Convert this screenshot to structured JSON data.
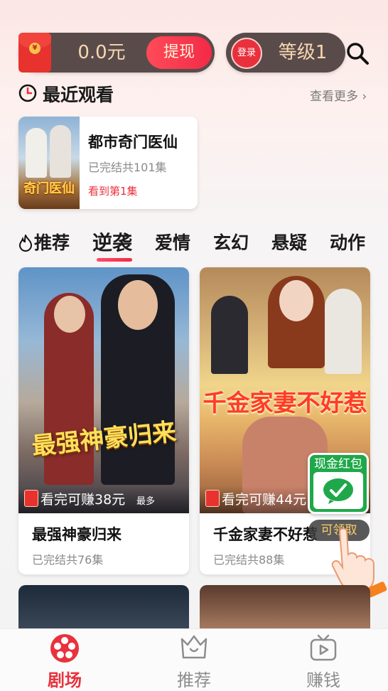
{
  "wallet": {
    "balance": "0.0元",
    "withdraw_label": "提现",
    "packet_symbol": "¥"
  },
  "level": {
    "login_label": "登录",
    "level_label": "等级1"
  },
  "recent": {
    "title": "最近观看",
    "see_more": "查看更多",
    "item": {
      "name": "都市奇门医仙",
      "poster_text": "奇门医仙",
      "episodes": "已完结共101集",
      "progress": "看到第1集"
    }
  },
  "tabs": [
    "推荐",
    "逆袭",
    "爱情",
    "玄幻",
    "悬疑",
    "动作"
  ],
  "active_tab": "逆袭",
  "cards": [
    {
      "poster_title": "最强神豪归来",
      "earn": "看完可赚38元",
      "earn_max": "最多",
      "title": "最强神豪归来",
      "episodes": "已完结共76集"
    },
    {
      "poster_title": "千金家妻不好惹",
      "earn": "看完可赚44元",
      "title": "千金家妻不好惹",
      "episodes": "已完结共88集"
    }
  ],
  "red_packet": {
    "label": "现金红包",
    "claim": "可领取"
  },
  "bottom_nav": [
    {
      "label": "剧场",
      "icon": "film-reel-icon",
      "active": true
    },
    {
      "label": "推荐",
      "icon": "crown-tv-icon",
      "active": false
    },
    {
      "label": "赚钱",
      "icon": "play-tv-icon",
      "active": false
    }
  ],
  "colors": {
    "accent": "#e8323d",
    "pill_bg": "#5a4b4b",
    "gold_text": "#f6d8b0",
    "wechat_green": "#1fa84a"
  }
}
